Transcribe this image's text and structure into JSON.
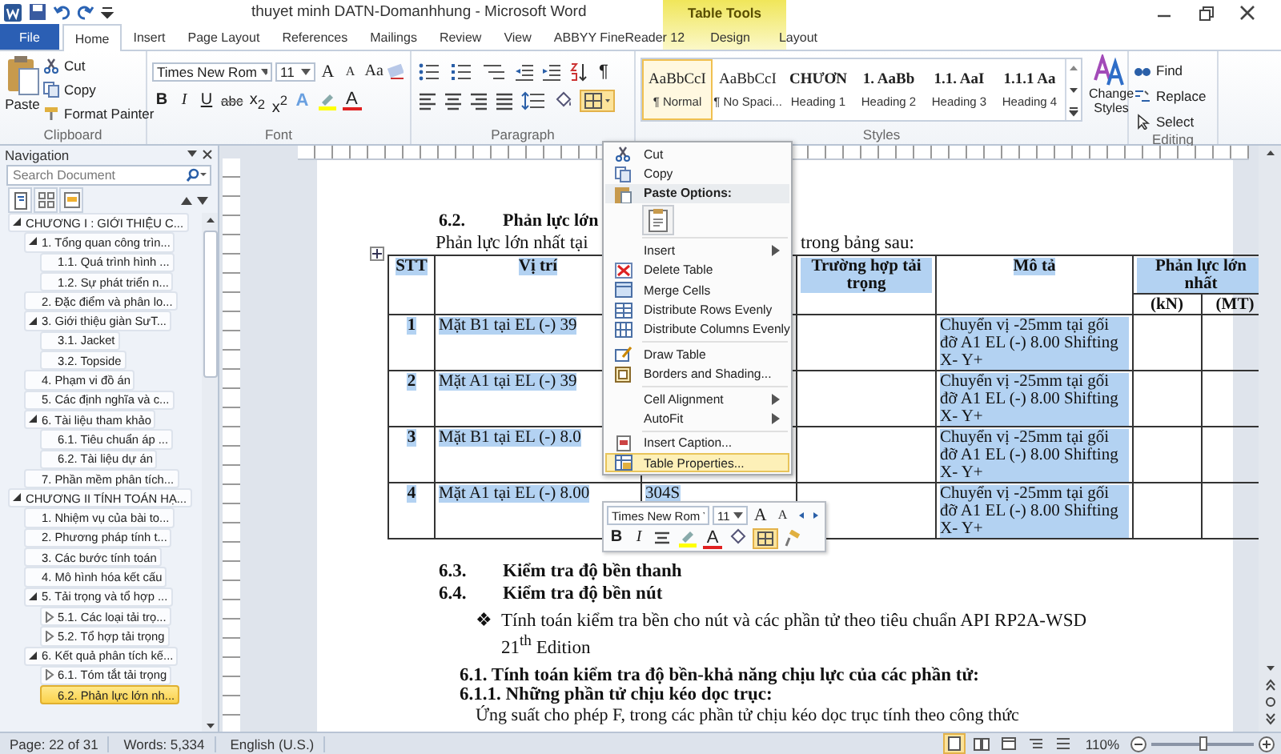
{
  "title_bar": {
    "title": "thuyet minh DATN-Domanhhung - Microsoft Word",
    "contextual_label": "Table Tools"
  },
  "tabs": [
    {
      "label": "File",
      "kind": "file",
      "selected": false
    },
    {
      "label": "Home",
      "kind": "tab",
      "selected": true
    },
    {
      "label": "Insert",
      "kind": "tab",
      "selected": false
    },
    {
      "label": "Page Layout",
      "kind": "tab",
      "selected": false
    },
    {
      "label": "References",
      "kind": "tab",
      "selected": false
    },
    {
      "label": "Mailings",
      "kind": "tab",
      "selected": false
    },
    {
      "label": "Review",
      "kind": "tab",
      "selected": false
    },
    {
      "label": "View",
      "kind": "tab",
      "selected": false
    },
    {
      "label": "ABBYY FineReader 12",
      "kind": "tab",
      "selected": false
    },
    {
      "label": "Design",
      "kind": "contextual",
      "selected": false
    },
    {
      "label": "Layout",
      "kind": "contextual",
      "selected": false
    }
  ],
  "ribbon": {
    "clipboard": {
      "paste": "Paste",
      "cut": "Cut",
      "copy": "Copy",
      "format_painter": "Format Painter",
      "label": "Clipboard"
    },
    "font": {
      "name": "Times New Rom",
      "size": "11",
      "grow": "A",
      "shrink": "A",
      "change_case": "Aa",
      "format_buttons": [
        {
          "label": "B",
          "kind": "bold"
        },
        {
          "label": "I",
          "kind": "italic"
        },
        {
          "label": "U",
          "kind": "underline"
        },
        {
          "label": "abc",
          "kind": "strike"
        },
        {
          "label": "x$_{2}$",
          "kind": "plain"
        },
        {
          "label": "x$^{2}$",
          "kind": "plain"
        }
      ],
      "effects": "A",
      "font_color": "A",
      "label": "Font"
    },
    "paragraph": {
      "pilcrow": "¶",
      "borders_on": true,
      "label": "Paragraph"
    },
    "styles": {
      "items": [
        {
          "preview": "AaBbCcI",
          "name": "¶ Normal",
          "kind": "body",
          "selected": true
        },
        {
          "preview": "AaBbCcI",
          "name": "¶ No Spaci...",
          "kind": "body",
          "selected": false
        },
        {
          "preview": "CHƯƠN",
          "name": "Heading 1",
          "kind": "heading",
          "selected": false
        },
        {
          "preview": "1. AaBb",
          "name": "Heading 2",
          "kind": "heading",
          "selected": false
        },
        {
          "preview": "1.1. AaI",
          "name": "Heading 3",
          "kind": "heading",
          "selected": false
        },
        {
          "preview": "1.1.1 Aa",
          "name": "Heading 4",
          "kind": "heading",
          "selected": false
        }
      ],
      "change_styles": "Change Styles",
      "label": "Styles"
    },
    "editing": {
      "find": "Find",
      "replace": "Replace",
      "select": "Select",
      "label": "Editing"
    }
  },
  "navigation": {
    "title": "Navigation",
    "search_placeholder": "Search Document",
    "tree": [
      {
        "label": "CHƯƠNG I : GIỚI THIỆU C...",
        "expanded": true,
        "selected": false,
        "children": [
          {
            "label": "1. Tổng quan công trìn...",
            "expanded": true,
            "selected": false,
            "children": [
              {
                "label": "1.1. Quá trình hình ...",
                "selected": false
              },
              {
                "label": "1.2. Sự phát triển n...",
                "selected": false
              }
            ]
          },
          {
            "label": "2. Đặc điểm và phân lo...",
            "selected": false
          },
          {
            "label": "3. Giới thiệu giàn SưT...",
            "expanded": true,
            "selected": false,
            "children": [
              {
                "label": "3.1. Jacket",
                "selected": false
              },
              {
                "label": "3.2. Topside",
                "selected": false
              }
            ]
          },
          {
            "label": "4. Phạm vi đồ án",
            "selected": false
          },
          {
            "label": "5. Các định nghĩa và c...",
            "selected": false
          },
          {
            "label": "6. Tài liệu tham khảo",
            "expanded": true,
            "selected": false,
            "children": [
              {
                "label": "6.1. Tiêu chuẩn áp ...",
                "selected": false
              },
              {
                "label": "6.2. Tài liệu dự án",
                "selected": false
              }
            ]
          },
          {
            "label": "7. Phần mềm phân tích...",
            "selected": false
          }
        ]
      },
      {
        "label": "CHƯƠNG II TÍNH TOÁN HẠ...",
        "expanded": true,
        "selected": false,
        "children": [
          {
            "label": "1. Nhiệm vụ của bài to...",
            "selected": false
          },
          {
            "label": "2. Phương pháp tính t...",
            "selected": false
          },
          {
            "label": "3. Các bước tính toán",
            "selected": false
          },
          {
            "label": "4. Mô hình hóa kết cấu",
            "selected": false
          },
          {
            "label": "5. Tải trọng và tổ hợp ...",
            "expanded": true,
            "selected": false,
            "children": [
              {
                "label": "5.1.  Các loại tải trọ...",
                "expanded": false,
                "selected": false
              },
              {
                "label": "5.2. Tổ hợp tải trọng",
                "expanded": false,
                "selected": false
              }
            ]
          },
          {
            "label": "6. Kết quả phân tích kế...",
            "expanded": true,
            "selected": false,
            "children": [
              {
                "label": "6.1. Tóm tắt tải trọng",
                "expanded": false,
                "selected": false
              },
              {
                "label": "6.2. Phản lực lớn nh...",
                "selected": true
              }
            ]
          }
        ]
      }
    ]
  },
  "document": {
    "section_heading": {
      "number": "6.2.",
      "text": "Phản lực lớn"
    },
    "intro": {
      "left": "Phản lực lớn nhất tại",
      "right": "trong bảng sau:"
    },
    "table": {
      "header": {
        "stt": "STT",
        "position": "Vị trí",
        "load_case": "Trường hợp tải trọng",
        "description": "Mô tả",
        "reaction": "Phản lực lớn nhất",
        "units": [
          "(kN)",
          "(MT)"
        ]
      },
      "rows": [
        {
          "stt": "1",
          "position": "Mặt B1 tại EL (-) 39",
          "description": "Chuyển vị -25mm tại gối đỡ A1  EL (-) 8.00 Shifting X- Y+"
        },
        {
          "stt": "2",
          "position": "Mặt A1 tại EL (-) 39",
          "description": "Chuyển vị -25mm tại gối đỡ A1  EL (-) 8.00 Shifting X- Y+"
        },
        {
          "stt": "3",
          "position": "Mặt B1 tại EL (-) 8.0",
          "description": "Chuyển vị -25mm tại gối đỡ A1  EL (-) 8.00 Shifting X- Y+"
        },
        {
          "stt": "4",
          "position": "Mặt A1 tại EL (-) 8.00",
          "column_3": "304S",
          "description": "Chuyển vị -25mm tại gối đỡ A1  EL (-) 8.00 Shifting X- Y+"
        }
      ]
    },
    "headings": [
      {
        "number": "6.3.",
        "text": "Kiểm tra độ bền thanh"
      },
      {
        "number": "6.4.",
        "text": "Kiểm tra độ bền nút"
      }
    ],
    "bullet": {
      "mark": "❖",
      "text": "Tính toán kiểm tra bền cho nút và các phần tử theo tiêu chuẩn API RP2A-WSD 21$^{th}$ Edition"
    },
    "subheadings": [
      "6.1. Tính toán kiểm tra độ bền-khả năng chịu lực của các phần tử:",
      "6.1.1. Những phần tử chịu kéo dọc trục:"
    ],
    "body": "Ứng suất cho phép F, trong các phần tử chịu kéo dọc trục tính theo công thức"
  },
  "context_menu": {
    "groups": [
      {
        "items": [
          {
            "label": "Cut",
            "kind": "cut",
            "selected": false
          },
          {
            "label": "Copy",
            "kind": "copy",
            "selected": false
          },
          {
            "label": "Paste Options:",
            "kind": "header"
          },
          {
            "kind": "paste",
            "selected": false
          }
        ]
      },
      {
        "items": [
          {
            "label": "Insert",
            "kind": "plain",
            "submenu": true,
            "selected": false
          },
          {
            "label": "Delete Table",
            "kind": "delete",
            "selected": false
          },
          {
            "label": "Merge Cells",
            "kind": "merge",
            "selected": false
          },
          {
            "label": "Distribute Rows Evenly",
            "kind": "rows",
            "selected": false
          },
          {
            "label": "Distribute Columns Evenly",
            "kind": "cols",
            "selected": false
          }
        ]
      },
      {
        "items": [
          {
            "label": "Draw Table",
            "kind": "draw",
            "selected": false
          },
          {
            "label": "Borders and Shading...",
            "kind": "borders",
            "selected": false
          }
        ]
      },
      {
        "items": [
          {
            "label": "Cell Alignment",
            "kind": "plain",
            "submenu": true,
            "selected": false
          },
          {
            "label": "AutoFit",
            "kind": "plain",
            "submenu": true,
            "selected": false
          }
        ]
      },
      {
        "items": [
          {
            "label": "Insert Caption...",
            "kind": "caption",
            "selected": false
          },
          {
            "label": "Table Properties...",
            "kind": "properties",
            "selected": true
          }
        ]
      }
    ]
  },
  "mini_toolbar": {
    "font": "Times New Rom",
    "size": "11",
    "grow": "A",
    "shrink": "A",
    "bold": "B",
    "italic": "I",
    "font_color": "A",
    "borders_on": true
  },
  "status_bar": {
    "page": "Page: 22 of 31",
    "words": "Words: 5,334",
    "language": "English (U.S.)",
    "views": [
      {
        "kind": "print",
        "selected": true
      },
      {
        "kind": "reading",
        "selected": false
      },
      {
        "kind": "web",
        "selected": false
      },
      {
        "kind": "outline",
        "selected": false
      },
      {
        "kind": "draft",
        "selected": false
      }
    ],
    "zoom": "110%",
    "zoom_slider": {
      "level": 0.5
    }
  }
}
